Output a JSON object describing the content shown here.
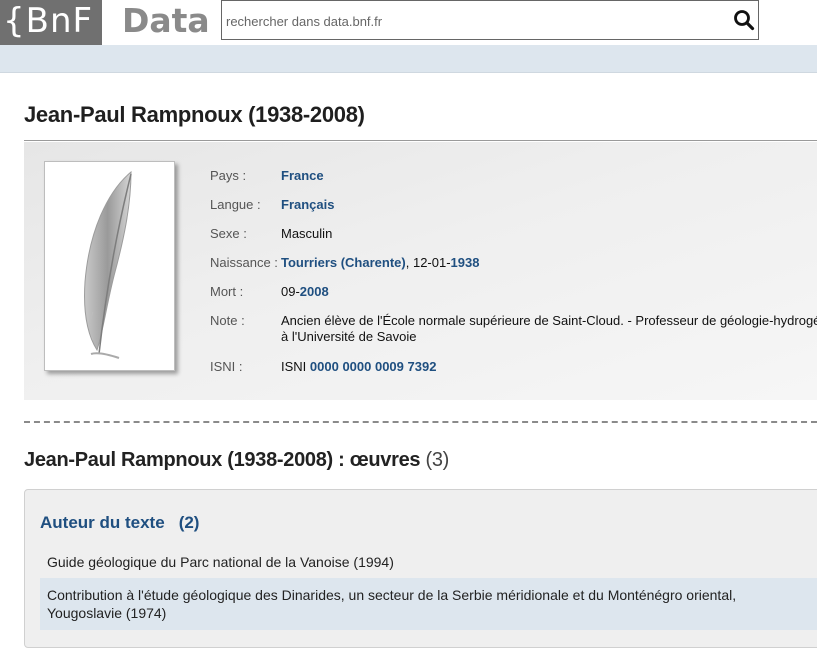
{
  "header": {
    "logo_left": "{BnF",
    "logo_right": "Data",
    "search_placeholder": "rechercher dans data.bnf.fr"
  },
  "author": {
    "title": "Jean-Paul Rampnoux (1938-2008)",
    "fields": {
      "pays_label": "Pays :",
      "pays_value": "France",
      "langue_label": "Langue :",
      "langue_value": "Français",
      "sexe_label": "Sexe :",
      "sexe_value": "Masculin",
      "naissance_label": "Naissance :",
      "naissance_place": "Tourriers (Charente)",
      "naissance_sep": ", 12-01-",
      "naissance_year": "1938",
      "mort_label": "Mort :",
      "mort_prefix": "09-",
      "mort_year": "2008",
      "note_label": "Note :",
      "note_line1": "Ancien élève de l'École normale supérieure de Saint-Cloud. - Professeur de géologie-hydrogéologie",
      "note_line2": "à l'Université de Savoie",
      "isni_label": "ISNI :",
      "isni_prefix": "ISNI ",
      "isni_value": "0000 0000 0009 7392"
    }
  },
  "works": {
    "title": "Jean-Paul Rampnoux (1938-2008) : œuvres",
    "count": "(3)",
    "section_label": "Auteur du texte",
    "section_count": "(2)",
    "items": [
      {
        "line1": "Guide géologique du Parc national de la Vanoise (1994)",
        "line2": ""
      },
      {
        "line1": "Contribution à l'étude géologique des Dinarides, un secteur de la Serbie méridionale et du Monténégro oriental,",
        "line2": "Yougoslavie (1974)"
      }
    ]
  },
  "colors": {
    "link": "#1f4f80",
    "logo_bg": "#707070",
    "band": "#dde6ee"
  }
}
